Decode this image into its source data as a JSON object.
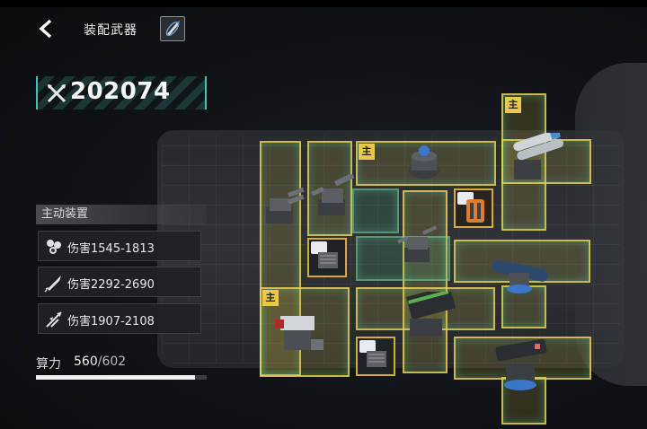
{
  "header": {
    "title": "装配武器"
  },
  "power": {
    "value": "202074"
  },
  "panel": {
    "title": "主动装置",
    "devices": [
      {
        "label": "伤害1545-1813",
        "icon": "drone-swarm-icon"
      },
      {
        "label": "伤害2292-2690",
        "icon": "missile-icon"
      },
      {
        "label": "伤害1907-2108",
        "icon": "strike-fighters-icon"
      }
    ]
  },
  "compute": {
    "label": "算力",
    "used": "560",
    "max": "/602",
    "fill_ratio": 0.93
  },
  "main_tag": "主",
  "colors": {
    "slot_border": "#e6cd5a",
    "accent_teal": "#3cc9b4",
    "tag": "#e8c94a"
  }
}
